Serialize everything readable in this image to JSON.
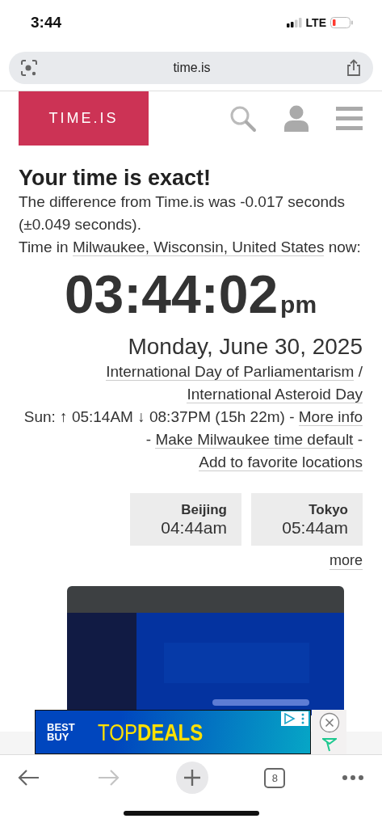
{
  "status_bar": {
    "time": "3:44",
    "network": "LTE"
  },
  "browser": {
    "url": "time.is",
    "tab_count": "8",
    "forward_disabled": true
  },
  "site": {
    "logo": "TIME.IS"
  },
  "result": {
    "title": "Your time is exact!",
    "difference": "The difference from Time.is was -0.017 seconds (±0.049 seconds).",
    "location_prefix": "Time in",
    "location_link": "Milwaukee, Wisconsin, United States",
    "location_suffix": "now:"
  },
  "clock": {
    "time": "03:44:02",
    "period": "pm"
  },
  "date": "Monday, June 30, 2025",
  "holidays": {
    "separator": "/",
    "items": [
      "International Day of Parliamentarism",
      "International Asteroid Day"
    ]
  },
  "sun": {
    "text": "Sun: ↑ 05:14AM ↓ 08:37PM (15h 22m)",
    "separator": "-",
    "links": [
      "More info",
      "Make Milwaukee time default",
      "Add to favorite locations"
    ]
  },
  "cities": [
    {
      "name": "Beijing",
      "time": "04:44am"
    },
    {
      "name": "Tokyo",
      "time": "05:44am"
    }
  ],
  "more": "more",
  "banner": {
    "brand_top": "BEST",
    "brand_bottom": "BUY",
    "headline_light": "TOP",
    "headline_bold": "DEALS"
  }
}
